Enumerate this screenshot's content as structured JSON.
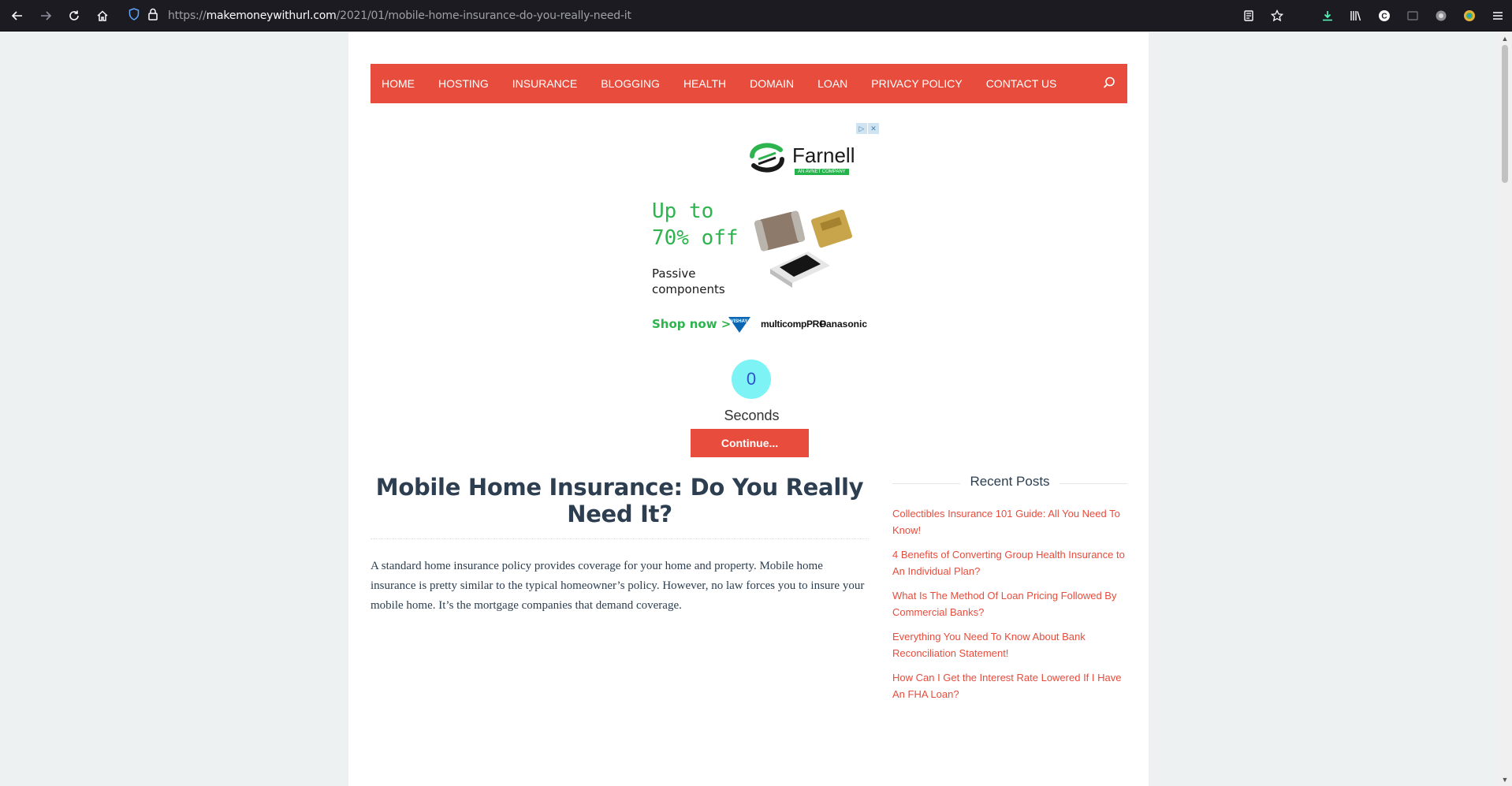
{
  "browser": {
    "url_scheme": "https://",
    "url_host": "makemoneywithurl.com",
    "url_path": "/2021/01/mobile-home-insurance-do-you-really-need-it"
  },
  "nav": {
    "items": [
      "HOME",
      "HOSTING",
      "INSURANCE",
      "BLOGGING",
      "HEALTH",
      "DOMAIN",
      "LOAN",
      "PRIVACY POLICY",
      "CONTACT US"
    ]
  },
  "ad": {
    "brand": "Farnell",
    "brand_tag": "AN AVNET COMPANY",
    "headline": "Up to 70% off",
    "subtext": "Passive components",
    "cta": "Shop now >",
    "partner_vishay": "VISHAY.",
    "partner_multicomp": "multicompPRO",
    "partner_panasonic": "Panasonic"
  },
  "timer": {
    "count": "0",
    "label": "Seconds",
    "continue_label": "Continue..."
  },
  "article": {
    "title": "Mobile Home Insurance: Do You Really Need It?",
    "body": "A standard home insurance policy provides coverage for your home and property. Mobile home insurance is pretty similar to the typical homeowner’s policy. However, no law forces you to insure your mobile home. It’s the mortgage companies that demand coverage."
  },
  "sidebar": {
    "title": "Recent Posts",
    "posts": [
      "Collectibles Insurance 101 Guide: All You Need To Know!",
      "4 Benefits of Converting Group Health Insurance to An Individual Plan?",
      "What Is The Method Of Loan Pricing Followed By Commercial Banks?",
      "Everything You Need To Know About Bank Reconciliation Statement!",
      "How Can I Get the Interest Rate Lowered If I Have An FHA Loan?"
    ]
  },
  "colors": {
    "accent": "#e74c3c",
    "ad_green": "#2eb44e",
    "counter_bg": "#7ef3f6",
    "heading": "#2c3e50"
  }
}
